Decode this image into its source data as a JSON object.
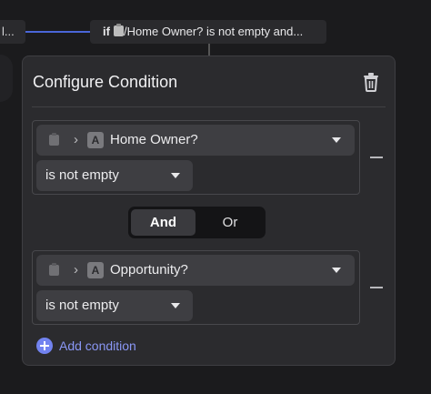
{
  "canvas": {
    "left_node_text": "l...",
    "node_chip": {
      "keyword": "if",
      "text": "/Home Owner? is not empty and..."
    }
  },
  "panel": {
    "title": "Configure Condition",
    "delete_icon": "trash-icon",
    "conditions": [
      {
        "field": "Home Owner?",
        "field_type": "A",
        "operator": "is not empty"
      },
      {
        "field": "Opportunity?",
        "field_type": "A",
        "operator": "is not empty"
      }
    ],
    "logic_toggle": {
      "options": [
        "And",
        "Or"
      ],
      "selected": "And"
    },
    "add_condition_label": "Add condition"
  },
  "colors": {
    "accent": "#7283f0",
    "connector": "#4a66d8",
    "panel_bg": "#2b2b2e",
    "page_bg": "#1b1b1d"
  }
}
